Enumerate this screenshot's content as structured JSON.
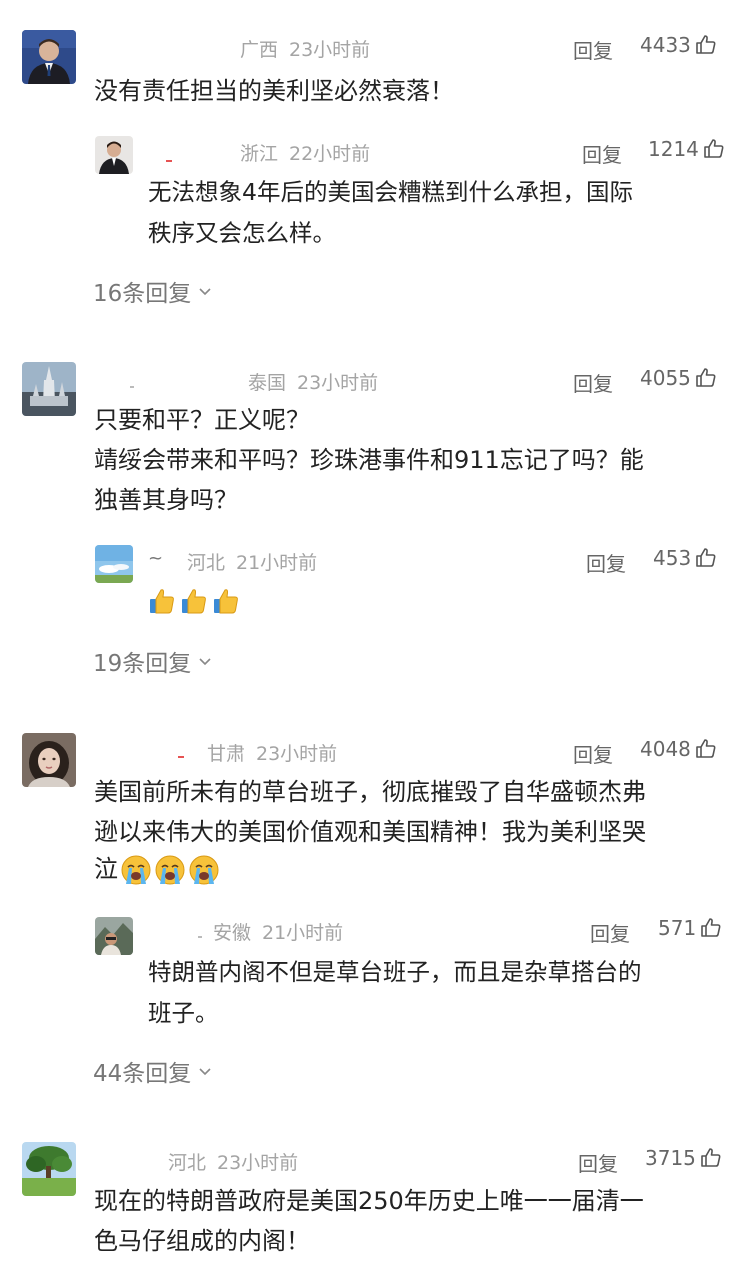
{
  "comments": [
    {
      "location": "广西",
      "time": "23小时前",
      "reply_label": "回复",
      "likes": "4433",
      "text": "没有责任担当的美利坚必然衰落！",
      "replies": [
        {
          "location": "浙江",
          "time": "22小时前",
          "reply_label": "回复",
          "likes": "1214",
          "text_line1": "无法想象4年后的美国会糟糕到什么承担，国际",
          "text_line2": "秩序又会怎么样。"
        }
      ],
      "more_replies": "16条回复"
    },
    {
      "location": "泰国",
      "time": "23小时前",
      "reply_label": "回复",
      "likes": "4055",
      "text_line1": "只要和平？正义呢？",
      "text_line2": "靖绥会带来和平吗？珍珠港事件和911忘记了吗？能",
      "text_line3": "独善其身吗？",
      "replies": [
        {
          "username": "~",
          "location": "河北",
          "time": "21小时前",
          "reply_label": "回复",
          "likes": "453",
          "emoji": [
            "thumbs-up",
            "thumbs-up",
            "thumbs-up"
          ]
        }
      ],
      "more_replies": "19条回复"
    },
    {
      "location": "甘肃",
      "time": "23小时前",
      "reply_label": "回复",
      "likes": "4048",
      "text_line1": "美国前所未有的草台班子，彻底摧毁了自华盛顿杰弗",
      "text_line2": "逊以来伟大的美国价值观和美国精神！我为美利坚哭",
      "text_line3": "泣",
      "emoji": [
        "loudly-crying",
        "loudly-crying",
        "loudly-crying"
      ],
      "replies": [
        {
          "location": "安徽",
          "time": "21小时前",
          "reply_label": "回复",
          "likes": "571",
          "text_line1": "特朗普内阁不但是草台班子，而且是杂草搭台的",
          "text_line2": "班子。"
        }
      ],
      "more_replies": "44条回复"
    },
    {
      "location": "河北",
      "time": "23小时前",
      "reply_label": "回复",
      "likes": "3715",
      "text_line1": "现在的特朗普政府是美国250年历史上唯一一届清一",
      "text_line2": "色马仔组成的内阁！"
    }
  ],
  "colors": {
    "text": "#222222",
    "meta": "#a4a4a4",
    "action": "#666666",
    "more": "#777777"
  }
}
